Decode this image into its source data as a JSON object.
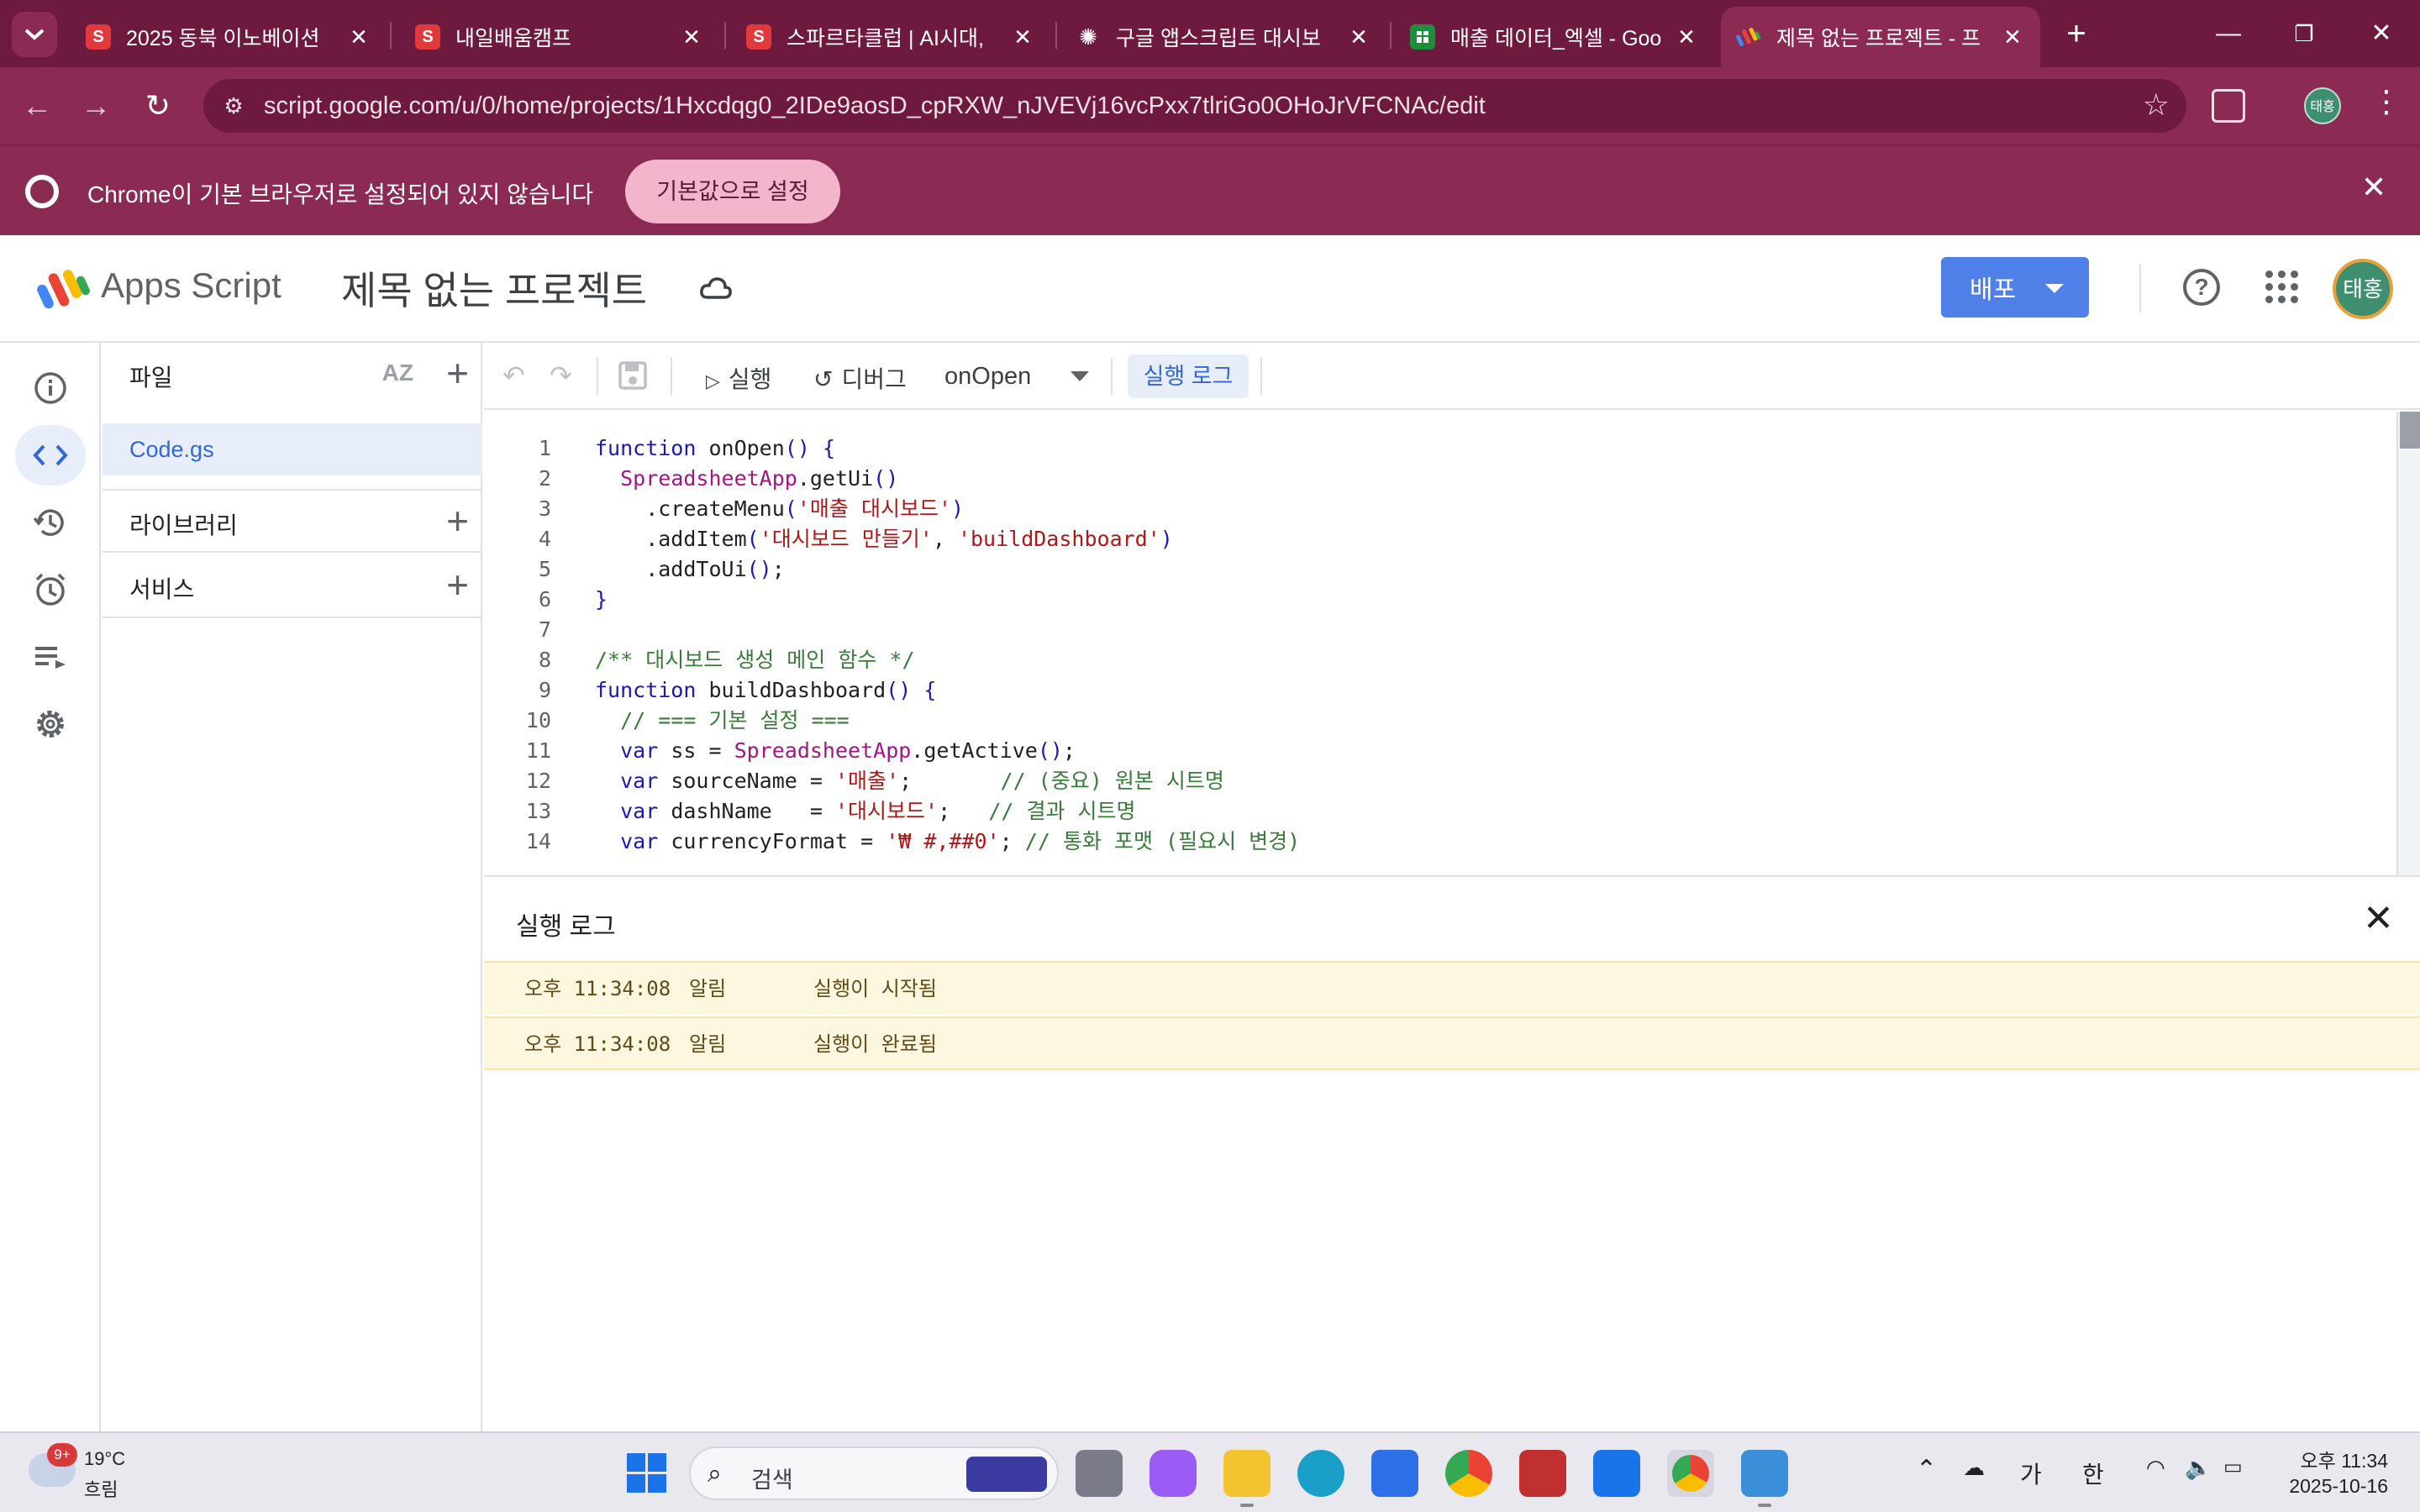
{
  "browser": {
    "tabs": [
      {
        "title": "2025 동북 이노베이션 ",
        "favicon": "S",
        "favicon_color": "#e03a3e",
        "active": false
      },
      {
        "title": "내일배움캠프",
        "favicon": "S",
        "favicon_color": "#e03a3e",
        "active": false
      },
      {
        "title": "스파르타클럽 | AI시대,",
        "favicon": "S",
        "favicon_color": "#e03a3e",
        "active": false
      },
      {
        "title": "구글 앱스크립트 대시보",
        "favicon": "chatgpt-icon",
        "favicon_color": "#ffffff",
        "active": false
      },
      {
        "title": "매출 데이터_엑셀 - Goo",
        "favicon": "sheets-icon",
        "favicon_color": "#1e8e3e",
        "active": false
      },
      {
        "title": "제목 없는 프로젝트 - 프",
        "favicon": "apps-script-icon",
        "favicon_color": "#f4b400",
        "active": true
      }
    ],
    "new_tab_label": "+",
    "url": "script.google.com/u/0/home/projects/1Hxcdqg0_2IDe9aosD_cpRXW_nJVEVj16vcPxx7tlriGo0OHoJrVFCNAc/edit",
    "profile_initials": "태홍",
    "theme_color": "#8b2a52",
    "tabstrip_color": "#6e1a3e"
  },
  "infobar": {
    "message": "Chrome이 기본 브라우저로 설정되어 있지 않습니다",
    "button_label": "기본값으로 설정"
  },
  "header": {
    "product_name": "Apps Script",
    "project_title": "제목 없는 프로젝트",
    "deploy_label": "배포",
    "deploy_color": "#4f80e8",
    "avatar_initials": "태홍",
    "avatar_color": "#3d8f6f"
  },
  "rail": {
    "items": [
      {
        "icon": "info-icon",
        "active": false
      },
      {
        "icon": "code-icon",
        "active": true
      },
      {
        "icon": "history-icon",
        "active": false
      },
      {
        "icon": "clock-trigger-icon",
        "active": false
      },
      {
        "icon": "executions-icon",
        "active": false
      },
      {
        "icon": "settings-icon",
        "active": false
      }
    ]
  },
  "files_panel": {
    "files_label": "파일",
    "sort_label": "AZ",
    "file_name": "Code.gs",
    "libraries_label": "라이브러리",
    "services_label": "서비스"
  },
  "editor_toolbar": {
    "run_label": "실행",
    "debug_label": "디버그",
    "function_name": "onOpen",
    "log_label": "실행 로그"
  },
  "code_lines": [
    "function onOpen() {",
    "  SpreadsheetApp.getUi()",
    "    .createMenu('매출 대시보드')",
    "    .addItem('대시보드 만들기', 'buildDashboard')",
    "    .addToUi();",
    "}",
    "",
    "/** 대시보드 생성 메인 함수 */",
    "function buildDashboard() {",
    "  // === 기본 설정 ===",
    "  var ss = SpreadsheetApp.getActive();",
    "  var sourceName = '매출';       // (중요) 원본 시트명",
    "  var dashName   = '대시보드';   // 결과 시트명",
    "  var currencyFormat = '₩ #,##0'; // 통화 포맷 (필요시 변경)"
  ],
  "execution_log": {
    "title": "실행 로그",
    "rows": [
      {
        "time": "오후 11:34:08",
        "level": "알림",
        "message": "실행이 시작됨"
      },
      {
        "time": "오후 11:34:08",
        "level": "알림",
        "message": "실행이 완료됨"
      }
    ],
    "row_color": "#fef7e0"
  },
  "taskbar": {
    "weather_badge": "9+",
    "weather_temp": "19°C",
    "weather_desc": "흐림",
    "search_label": "검색",
    "ime_mode": "가",
    "ime_lang": "한",
    "clock_time": "오후 11:34",
    "clock_date": "2025-10-16",
    "apps": [
      "task-view-icon",
      "copilot-icon",
      "file-explorer-icon",
      "edge-icon",
      "zoom-icon",
      "chrome-icon",
      "snipping-tool-icon",
      "store-icon",
      "chrome-profile-icon",
      "notepad-icon"
    ]
  }
}
